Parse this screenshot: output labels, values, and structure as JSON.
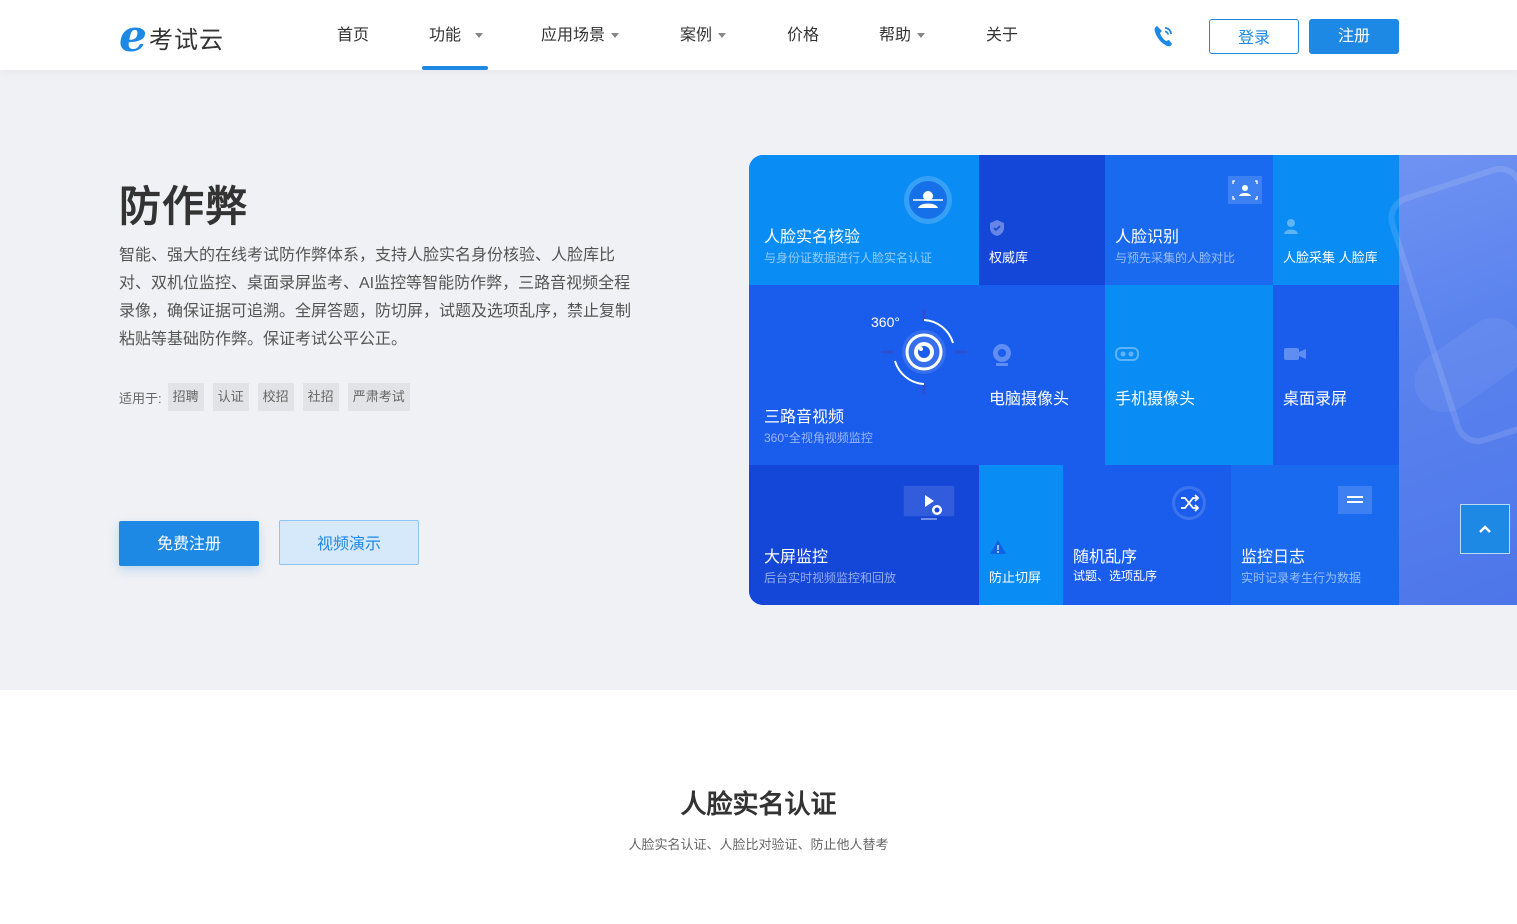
{
  "brand": {
    "logo_letter": "e",
    "name": "考试云"
  },
  "nav": {
    "items": [
      {
        "label": "首页",
        "has_caret": false
      },
      {
        "label": "功能",
        "has_caret": true,
        "active": true
      },
      {
        "label": "应用场景",
        "has_caret": true
      },
      {
        "label": "案例",
        "has_caret": true
      },
      {
        "label": "价格",
        "has_caret": false
      },
      {
        "label": "帮助",
        "has_caret": true
      },
      {
        "label": "关于",
        "has_caret": false
      }
    ],
    "login_label": "登录",
    "register_label": "注册"
  },
  "hero": {
    "title": "防作弊",
    "description": "智能、强大的在线考试防作弊体系，支持人脸实名身份核验、人脸库比对、双机位监控、桌面录屏监考、AI监控等智能防作弊，三路音视频全程录像，确保证据可追溯。全屏答题，防切屏，试题及选项乱序，禁止复制粘贴等基础防作弊。保证考试公平公正。",
    "tags_label": "适用于:",
    "tags": [
      "招聘",
      "认证",
      "校招",
      "社招",
      "严肃考试"
    ],
    "free_register_label": "免费注册",
    "video_demo_label": "视频演示"
  },
  "features": {
    "face_verify": {
      "title": "人脸实名核验",
      "sub": "与身份证数据进行人脸实名认证"
    },
    "authority_db": {
      "title": "权威库"
    },
    "face_recognize": {
      "title": "人脸识别",
      "sub": "与预先采集的人脸对比"
    },
    "face_collect": {
      "title": "人脸采集 人脸库"
    },
    "three_av": {
      "title": "三路音视频",
      "sub": "360°全视角视频监控",
      "badge": "360°"
    },
    "pc_camera": {
      "title": "电脑摄像头"
    },
    "phone_camera": {
      "title": "手机摄像头"
    },
    "desktop_record": {
      "title": "桌面录屏"
    },
    "big_screen": {
      "title": "大屏监控",
      "sub": "后台实时视频监控和回放"
    },
    "anti_switch": {
      "title": "防止切屏"
    },
    "random_order": {
      "title": "随机乱序",
      "sub": "试题、选项乱序"
    },
    "monitor_log": {
      "title": "监控日志",
      "sub": "实时记录考生行为数据"
    }
  },
  "section": {
    "title": "人脸实名认证",
    "subtitle": "人脸实名认证、人脸比对验证、防止他人替考"
  },
  "colors": {
    "accent": "#1e88e5",
    "hero_bg": "#f0f1f4",
    "tile_light": "#0a8cf5",
    "tile_mid": "#1a6af0",
    "tile_dark": "#1446d8"
  }
}
